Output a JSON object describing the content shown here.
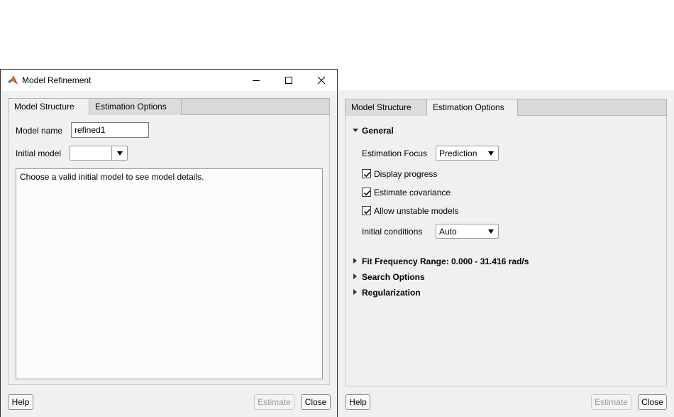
{
  "left_window": {
    "title": "Model Refinement",
    "tabs": [
      "Model Structure",
      "Estimation Options"
    ],
    "model_name_label": "Model name",
    "model_name_value": "refined1",
    "initial_model_label": "Initial model",
    "initial_model_value": "",
    "details_text": "Choose a valid initial model to see model details.",
    "buttons": {
      "help": "Help",
      "estimate": "Estimate",
      "close": "Close"
    }
  },
  "right_window": {
    "tabs": [
      "Model Structure",
      "Estimation Options"
    ],
    "sections": {
      "general": "General",
      "fit_frequency": "Fit Frequency Range: 0.000 - 31.416 rad/s",
      "search_options": "Search Options",
      "regularization": "Regularization"
    },
    "estimation_focus_label": "Estimation Focus",
    "estimation_focus_value": "Prediction",
    "checkboxes": [
      {
        "label": "Display progress",
        "checked": true
      },
      {
        "label": "Estimate covariance",
        "checked": true
      },
      {
        "label": "Allow unstable models",
        "checked": true
      }
    ],
    "initial_conditions_label": "Initial conditions",
    "initial_conditions_value": "Auto",
    "buttons": {
      "help": "Help",
      "estimate": "Estimate",
      "close": "Close"
    }
  },
  "icons": {
    "app": "matlab-logo-icon",
    "minimize": "minimize-icon",
    "maximize": "maximize-icon",
    "close": "close-icon",
    "dropdown": "chevron-down-icon",
    "checkmark": "checkmark-icon"
  }
}
